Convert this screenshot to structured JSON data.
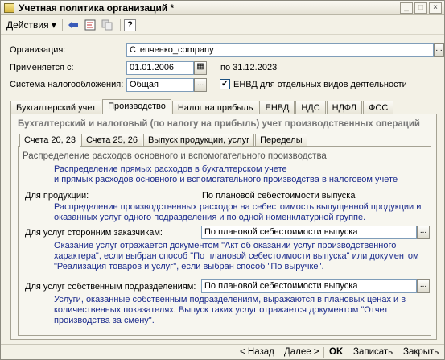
{
  "window": {
    "title": "Учетная политика организаций *"
  },
  "toolbar": {
    "actions_label": "Действия ▾",
    "help_label": "?"
  },
  "form": {
    "org_label": "Организация:",
    "org_value": "Степченко_company",
    "applies_label": "Применяется с:",
    "applies_value": "01.01.2006",
    "applies_to": "по 31.12.2023",
    "tax_label": "Система налогообложения:",
    "tax_value": "Общая",
    "envd_checked": "✓",
    "envd_label": "ЕНВД для отдельных видов деятельности"
  },
  "tabs": [
    "Бухгалтерский учет",
    "Производство",
    "Налог на прибыль",
    "ЕНВД",
    "НДС",
    "НДФЛ",
    "ФСС"
  ],
  "panel": {
    "heading": "Бухгалтерский и налоговый (по налогу на прибыль) учет производственных операций",
    "subtabs": [
      "Счета 20, 23",
      "Счета 25, 26",
      "Выпуск продукции, услуг",
      "Переделы"
    ],
    "section_heading": "Распределение расходов основного и вспомогательного производства",
    "intro_line1": "Распределение прямых расходов в бухгалтерском учете",
    "intro_line2": "и прямых расходов основного и вспомогательного производства в налоговом учете",
    "products_label": "Для продукции:",
    "products_value": "По плановой себестоимости выпуска",
    "products_note1": "Распределение производственных расходов на себестоимость выпущенной продукции и",
    "products_note2": "оказанных услуг одного подразделения и по одной номенклатурной группе.",
    "ext_label": "Для услуг сторонним заказчикам:",
    "ext_value": "По плановой себестоимости выпуска",
    "ext_note1": "Оказание услуг отражается документом \"Акт об оказании услуг производственного",
    "ext_note2": "характера\", если выбран способ \"По плановой себестоимости выпуска\" или документом",
    "ext_note3": "\"Реализация товаров и услуг\", если выбран способ \"По выручке\".",
    "own_label": "Для услуг собственным подразделениям:",
    "own_value": "По плановой себестоимости выпуска",
    "own_note1": "Услуги, оказанные собственным подразделениям, выражаются в плановых ценах и в",
    "own_note2": "количественных показателях. Выпуск таких услуг отражается документом \"Отчет",
    "own_note3": "производства за смену\"."
  },
  "footer": {
    "back": "< Назад",
    "next": "Далее >",
    "ok": "OK",
    "save": "Записать",
    "close": "Закрыть"
  }
}
